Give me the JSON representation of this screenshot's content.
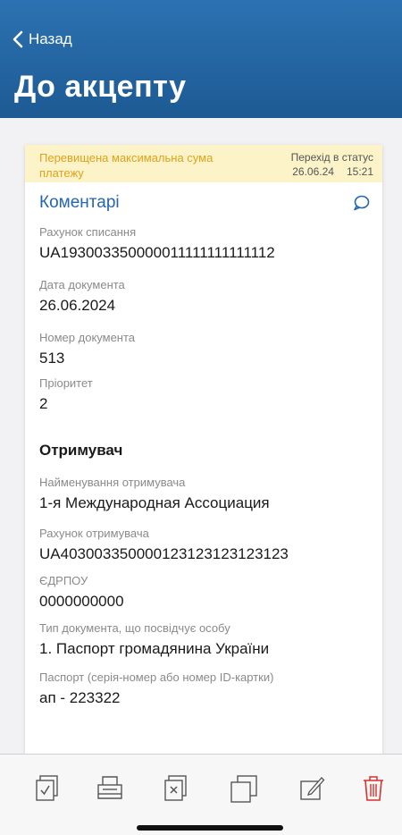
{
  "header": {
    "back_label": "Назад",
    "title": "До акцепту"
  },
  "status": {
    "message": "Перевищена максимальна сума платежу",
    "transition_label": "Перехід в статус",
    "date": "26.06.24",
    "time": "15:21"
  },
  "comments": {
    "label": "Коментарі"
  },
  "fields": [
    {
      "label": "Рахунок списання",
      "value": "UA193003350000011111111111112"
    },
    {
      "label": "Дата документа",
      "value": "26.06.2024"
    },
    {
      "label": "Номер документа",
      "value": "513"
    },
    {
      "label": "Пріоритет",
      "value": "2"
    }
  ],
  "recipient": {
    "section_title": "Отримувач",
    "fields": [
      {
        "label": "Найменування отримувача",
        "value": "1-я Международная Ассоциация"
      },
      {
        "label": "Рахунок отримувача",
        "value": "UA403003350000123123123123123"
      },
      {
        "label": "ЄДРПОУ",
        "value": "0000000000"
      },
      {
        "label": "Тип документа, що посвідчує особу",
        "value": "1.  Паспорт громадянина України"
      },
      {
        "label": "Паспорт (серія-номер або номер ID-картки)",
        "value": "ап - 223322"
      }
    ]
  },
  "toolbar": {
    "icons": [
      "sign-icon",
      "print-icon",
      "reject-icon",
      "copy-icon",
      "edit-icon",
      "delete-icon"
    ],
    "accent_color": "#2466b0",
    "delete_color": "#d9302a"
  }
}
